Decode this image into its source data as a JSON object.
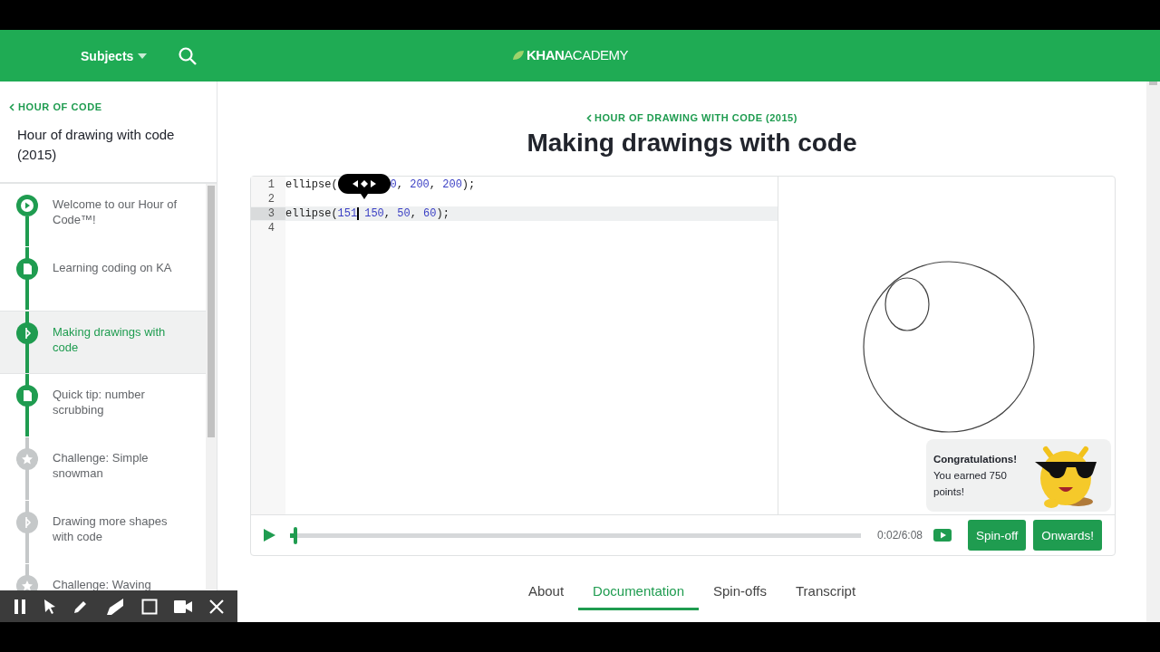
{
  "header": {
    "subjects": "Subjects",
    "logo": "**KHAN**ACADEMY"
  },
  "sidebar": {
    "back_link": "HOUR OF CODE",
    "title": "Hour of drawing with code (2015)",
    "items": [
      {
        "label": "Welcome to our Hour of Code™!",
        "kind": "video",
        "completed": true,
        "selected": false
      },
      {
        "label": "Learning coding on KA",
        "kind": "article",
        "completed": true,
        "selected": false
      },
      {
        "label": "Making drawings with code",
        "kind": "talkthrough",
        "completed": true,
        "selected": true
      },
      {
        "label": "Quick tip: number scrubbing",
        "kind": "article",
        "completed": true,
        "selected": false
      },
      {
        "label": "Challenge: Simple snowman",
        "kind": "challenge",
        "completed": false,
        "selected": false
      },
      {
        "label": "Drawing more shapes with code",
        "kind": "talkthrough",
        "completed": false,
        "selected": false
      },
      {
        "label": "Challenge: Waving",
        "kind": "challenge",
        "completed": false,
        "selected": false
      }
    ]
  },
  "breadcrumb": "HOUR OF DRAWING WITH CODE (2015)",
  "title": "Making drawings with code",
  "editor": {
    "lines": [
      {
        "number": "1",
        "active": false,
        "tokens": [
          {
            "kind": "plain",
            "text": "ellipse("
          },
          {
            "kind": "scrubber"
          },
          {
            "kind": "num",
            "text": "0"
          },
          {
            "kind": "plain",
            "text": ", "
          },
          {
            "kind": "num",
            "text": "200"
          },
          {
            "kind": "plain",
            "text": ", "
          },
          {
            "kind": "num",
            "text": "200"
          },
          {
            "kind": "plain",
            "text": ");"
          }
        ]
      },
      {
        "number": "2",
        "active": false
      },
      {
        "number": "3",
        "active": true,
        "tokens": [
          {
            "kind": "plain",
            "text": "ellipse("
          },
          {
            "kind": "num",
            "text": "151"
          },
          {
            "kind": "cursor"
          },
          {
            "kind": "num",
            "text": "150"
          },
          {
            "kind": "plain",
            "text": ", "
          },
          {
            "kind": "num",
            "text": "50"
          },
          {
            "kind": "plain",
            "text": ", "
          },
          {
            "kind": "num",
            "text": "60"
          },
          {
            "kind": "plain",
            "text": ");"
          }
        ]
      },
      {
        "number": "4",
        "active": false
      }
    ],
    "toast": {
      "heading": "Congratulations!",
      "message": "You earned 750 points!"
    },
    "player": {
      "level": 0.006,
      "time": "0:02/6:08",
      "buttons": [
        "Spin-off",
        "Onwards!"
      ]
    }
  },
  "tabs": [
    {
      "label": "About",
      "selected": false
    },
    {
      "label": "Documentation",
      "selected": true
    },
    {
      "label": "Spin-offs",
      "selected": false
    },
    {
      "label": "Transcript",
      "selected": false
    }
  ]
}
